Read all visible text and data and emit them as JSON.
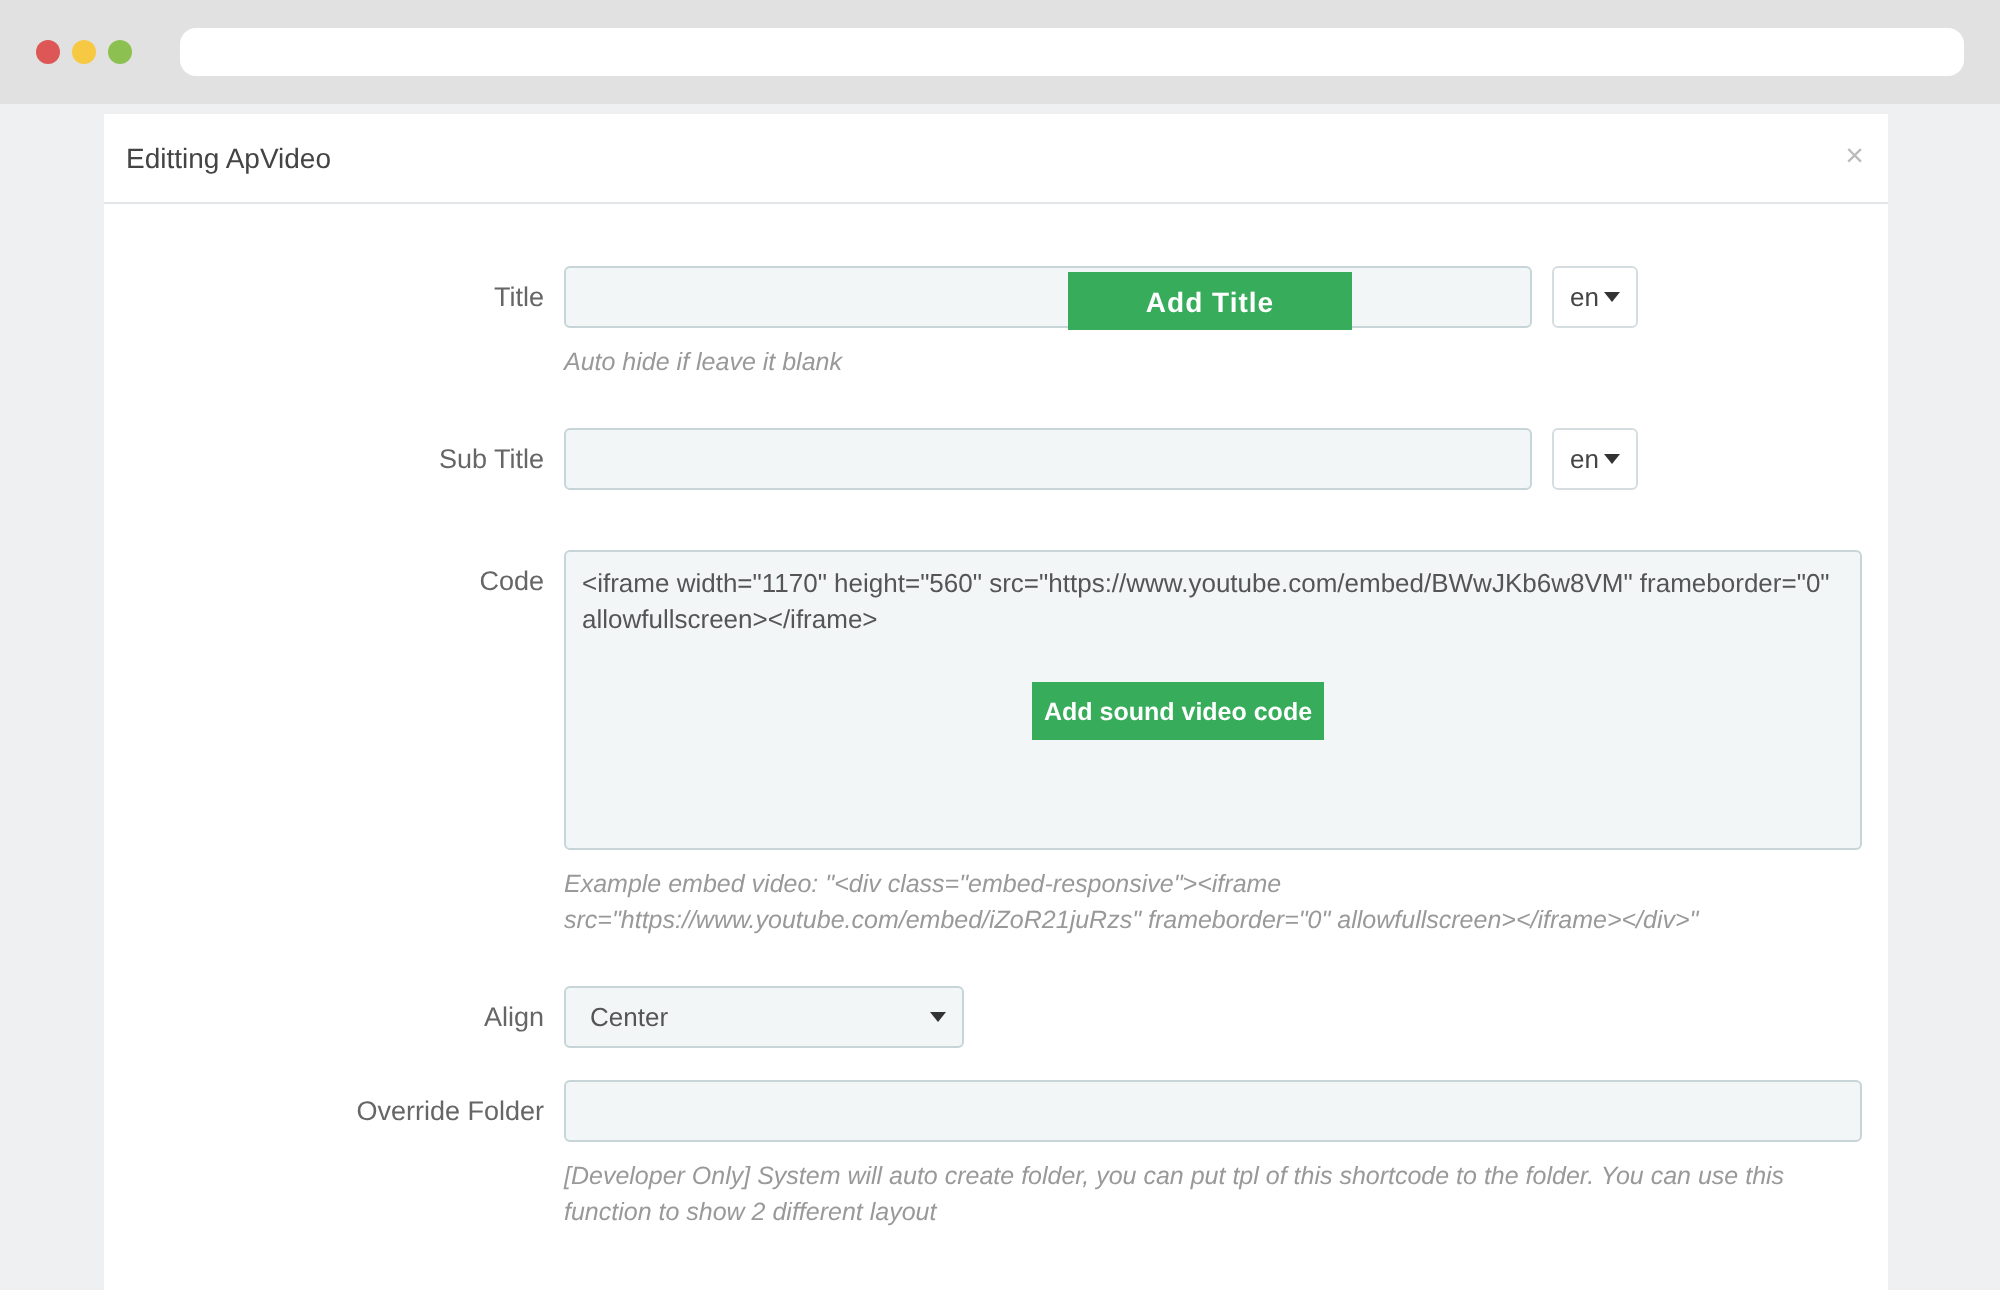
{
  "modal": {
    "title": "Editting ApVideo",
    "close": "×"
  },
  "fields": [
    {
      "kind": "text",
      "label": "Title",
      "lang": "en",
      "help": "Auto hide if leave it blank",
      "callout": "Add Title"
    },
    {
      "kind": "text",
      "label": "Sub Title",
      "lang": "en"
    },
    {
      "kind": "textarea",
      "label": "Code",
      "value": "<iframe width=\"1170\" height=\"560\" src=\"https://www.youtube.com/embed/BWwJKb6w8VM\" frameborder=\"0\" allowfullscreen></iframe>",
      "help": "Example embed video: \"<div class=\"embed-responsive\"><iframe src=\"https://www.youtube.com/embed/iZoR21juRzs\" frameborder=\"0\" allowfullscreen></iframe></div>\"",
      "callout": "Add sound video code"
    },
    {
      "kind": "select",
      "label": "Align",
      "value": "Center"
    },
    {
      "kind": "text",
      "label": "Override Folder",
      "help": "[Developer Only] System will auto create folder, you can put tpl of this shortcode to the folder. You can use this function to show 2 different layout"
    }
  ]
}
